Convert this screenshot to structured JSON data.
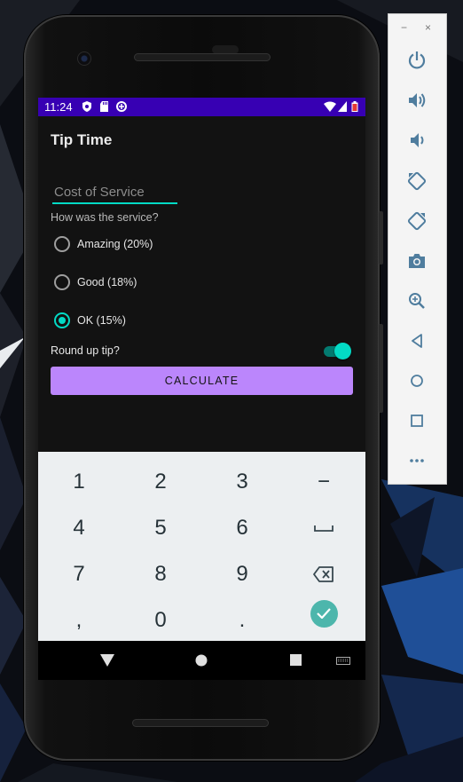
{
  "status_bar": {
    "time": "11:24"
  },
  "app": {
    "title": "Tip Time",
    "cost_field": {
      "placeholder": "Cost of Service",
      "value": ""
    },
    "service_question": "How was the service?",
    "service_options": [
      {
        "label": "Amazing (20%)",
        "selected": false
      },
      {
        "label": "Good (18%)",
        "selected": false
      },
      {
        "label": "OK (15%)",
        "selected": true
      }
    ],
    "round_up": {
      "label": "Round up tip?",
      "enabled": true
    },
    "calculate_button": "CALCULATE"
  },
  "keyboard": {
    "rows": [
      [
        "1",
        "2",
        "3",
        "−"
      ],
      [
        "4",
        "5",
        "6",
        "space-icon"
      ],
      [
        "7",
        "8",
        "9",
        "backspace-icon"
      ],
      [
        ",",
        "0",
        ".",
        "done-icon"
      ]
    ]
  },
  "navigation": [
    "back-icon",
    "home-icon",
    "recents-icon",
    "keyboard-switch-icon"
  ],
  "emulator_toolbar": {
    "window_controls": [
      "−",
      "×"
    ],
    "buttons": [
      "power-icon",
      "volume-up-icon",
      "volume-down-icon",
      "rotate-left-icon",
      "rotate-right-icon",
      "camera-icon",
      "zoom-icon",
      "back-icon",
      "home-icon",
      "overview-icon",
      "more-icon"
    ]
  },
  "colors": {
    "status_bar": "#3700b3",
    "accent": "#03dac5",
    "button": "#bb86fc",
    "screen_bg": "#121212",
    "keyboard_bg": "#eceff1",
    "done_key": "#4db6ac"
  }
}
